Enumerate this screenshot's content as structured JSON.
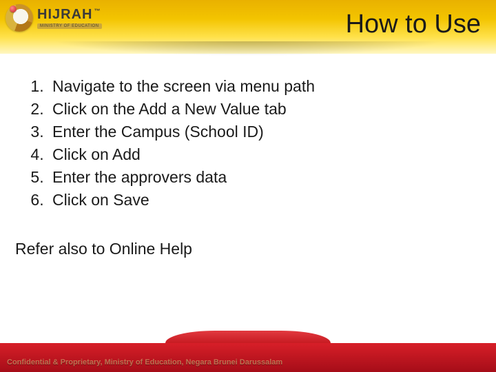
{
  "brand": {
    "name": "HIJRAH",
    "trademark": "™",
    "tagline": "MINISTRY OF EDUCATION"
  },
  "title": "How to Use",
  "steps": [
    "Navigate to the screen via menu path",
    "Click on the Add a New Value tab",
    "Enter the Campus (School ID)",
    "Click on Add",
    "Enter the approvers data",
    "Click on Save"
  ],
  "refer": "Refer also to Online Help",
  "footer": "Confidential & Proprietary, Ministry of Education, Negara Brunei Darussalam"
}
